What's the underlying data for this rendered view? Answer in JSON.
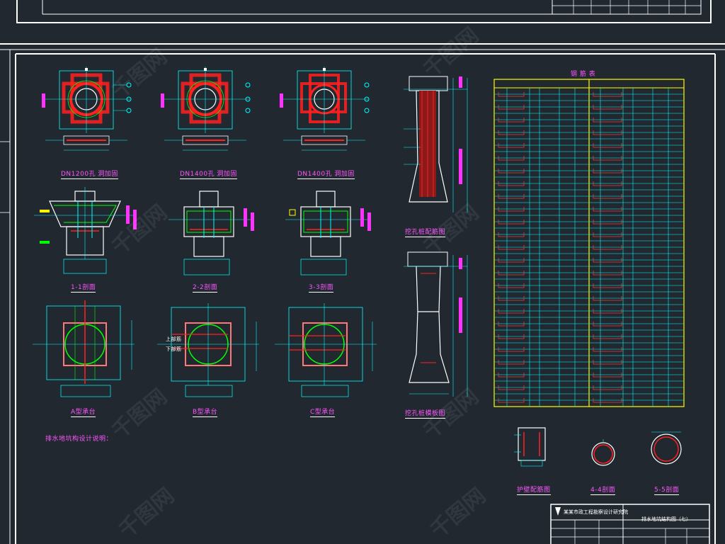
{
  "labels": {
    "hole_dn1200": "DN1200孔 洞加固",
    "hole_dn1400a": "DN1400孔 洞加固",
    "hole_dn1400b": "DN1400孔 洞加固",
    "sec_1_1": "1-1剖面",
    "sec_2_2": "2-2剖面",
    "sec_3_3": "3-3剖面",
    "cap_a": "A型承台",
    "cap_b": "B型承台",
    "cap_c": "C型承台",
    "pile_section": "挖孔桩配筋图",
    "pile_outline": "挖孔桩模板图",
    "wall_section": "护壁配筋图",
    "sec_4_4": "4-4剖面",
    "sec_5_5": "5-5剖面",
    "design_note": "排水地坑构设计说明：",
    "table_title": "钢 筋 表",
    "up_rebar": "上部筋",
    "down_rebar": "下部筋"
  },
  "title_block": {
    "company": "某某市政工程勘察设计研究院",
    "drawing_title": "排水地坑结构图（七）"
  },
  "watermark": "千图网",
  "colors": {
    "background": "#212830",
    "frame": "#ffffff",
    "rebar": "#ff2020",
    "dimension": "#00ffff",
    "concrete": "#ffffff",
    "label": "#ff55ff",
    "table_border": "#ffff00",
    "table_grid": "#00ffff",
    "circle": "#00ff00"
  }
}
